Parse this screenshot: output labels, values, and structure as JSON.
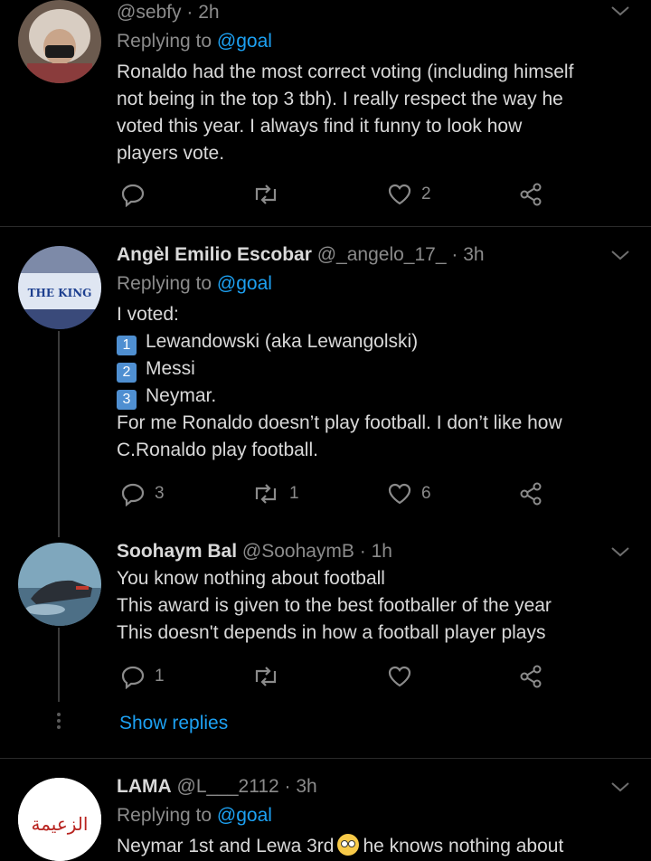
{
  "tweets": [
    {
      "name": "",
      "handle": "@sebfy",
      "time": "2h",
      "replying_label": "Replying to",
      "replying_to": "@goal",
      "lines": [
        "Ronaldo had the most correct voting (including himself",
        "not being in the top 3 tbh). I really respect the way he",
        "voted this year. I always find it funny to look how",
        "players vote."
      ],
      "reply_count": "",
      "retweet_count": "",
      "like_count": "2"
    },
    {
      "name": "Angèl Emilio Escobar",
      "handle": "@_angelo_17_",
      "time": "3h",
      "replying_label": "Replying to",
      "replying_to": "@goal",
      "intro": "I voted:",
      "list": [
        {
          "num": "1",
          "text": "Lewandowski (aka Lewangolski)"
        },
        {
          "num": "2",
          "text": "Messi"
        },
        {
          "num": "3",
          "text": "Neymar."
        }
      ],
      "lines": [
        "For me Ronaldo doesn’t play football. I don’t like how",
        "C.Ronaldo play football."
      ],
      "avatar_text": "THE KING",
      "reply_count": "3",
      "retweet_count": "1",
      "like_count": "6"
    },
    {
      "name": "Soohaym Bal",
      "handle": "@SoohaymB",
      "time": "1h",
      "lines": [
        "You know nothing about football",
        "This award is given to the best footballer of the year",
        "This doesn't depends in how a football player plays"
      ],
      "reply_count": "1",
      "retweet_count": "",
      "like_count": ""
    },
    {
      "name": "LAMA",
      "handle": "@L___2112",
      "time": "3h",
      "replying_label": "Replying to",
      "replying_to": "@goal",
      "line_start": "Neymar 1st and Lewa 3rd",
      "line_end": "he knows nothing about",
      "avatar_text": "الزعيمة"
    }
  ],
  "show_replies": "Show replies",
  "colors": {
    "link": "#1da1f2",
    "muted": "#8b8b8b",
    "text": "#d9d9d9",
    "background": "#000000"
  }
}
